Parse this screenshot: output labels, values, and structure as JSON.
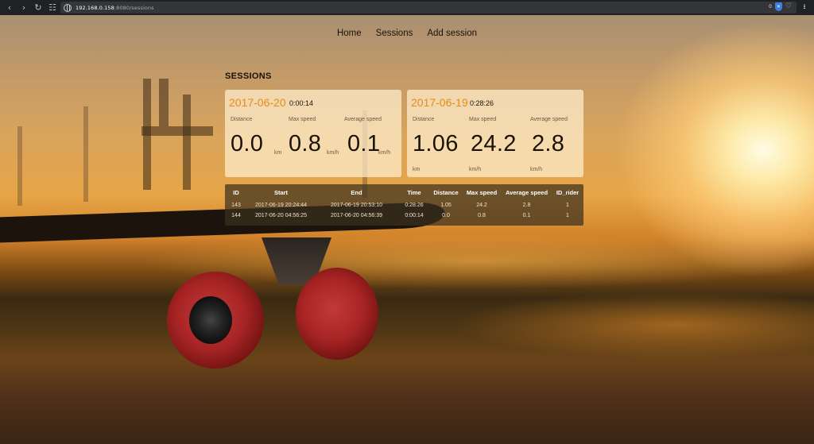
{
  "browser": {
    "url_host": "192.168.0.158",
    "url_path": ":8080/sessions",
    "badge_count": "0"
  },
  "nav": {
    "home": "Home",
    "sessions": "Sessions",
    "add_session": "Add session"
  },
  "page_title": "SESSIONS",
  "cards": [
    {
      "date": "2017-06-20",
      "duration": "0:00:14",
      "distance_label": "Distance",
      "max_speed_label": "Max speed",
      "avg_speed_label": "Average speed",
      "distance": "0.0",
      "distance_unit": "km",
      "max_speed": "0.8",
      "max_speed_unit": "km/h",
      "avg_speed": "0.1",
      "avg_speed_unit": "km/h"
    },
    {
      "date": "2017-06-19",
      "duration": "0:28:26",
      "distance_label": "Distance",
      "max_speed_label": "Max speed",
      "avg_speed_label": "Average speed",
      "distance": "1.06",
      "distance_unit": "km",
      "max_speed": "24.2",
      "max_speed_unit": "km/h",
      "avg_speed": "2.8",
      "avg_speed_unit": "km/h"
    }
  ],
  "table": {
    "headers": [
      "ID",
      "Start",
      "End",
      "Time",
      "Distance",
      "Max speed",
      "Average speed",
      "ID_rider"
    ],
    "rows": [
      [
        "143",
        "2017-06-19 20:24:44",
        "2017-06-19 20:53:10",
        "0:28:26",
        "1.05",
        "24.2",
        "2.8",
        "1"
      ],
      [
        "144",
        "2017-06-20 04:56:25",
        "2017-06-20 04:56:39",
        "0:00:14",
        "0.0",
        "0.8",
        "0.1",
        "1"
      ]
    ]
  },
  "colors": {
    "accent_date": "#e88a1a",
    "card_bg": "#ffeecd",
    "table_bg": "#3c301e"
  }
}
